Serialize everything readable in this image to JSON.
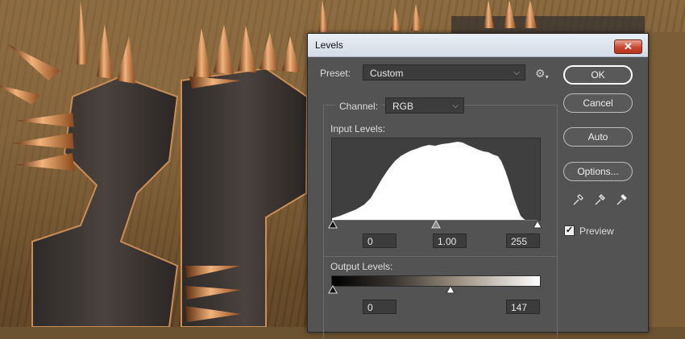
{
  "window": {
    "title": "Levels",
    "close": "✕"
  },
  "preset": {
    "label": "Preset:",
    "value": "Custom"
  },
  "channel": {
    "label": "Channel:",
    "value": "RGB"
  },
  "input_levels": {
    "label": "Input Levels:",
    "black": "0",
    "gamma": "1.00",
    "white": "255"
  },
  "output_levels": {
    "label": "Output Levels:",
    "black": "0",
    "white": "147"
  },
  "buttons": {
    "ok": "OK",
    "cancel": "Cancel",
    "auto": "Auto",
    "options": "Options..."
  },
  "preview": {
    "label": "Preview",
    "checked": true,
    "mark": "✓"
  },
  "icons": {
    "gear": "gear-icon",
    "eyedroppers": [
      "black-eyedropper-icon",
      "gray-eyedropper-icon",
      "white-eyedropper-icon"
    ]
  },
  "colors": {
    "dialog_bg": "#535353",
    "field_bg": "#3c3c3c",
    "histogram_fill": "#ffffff"
  }
}
